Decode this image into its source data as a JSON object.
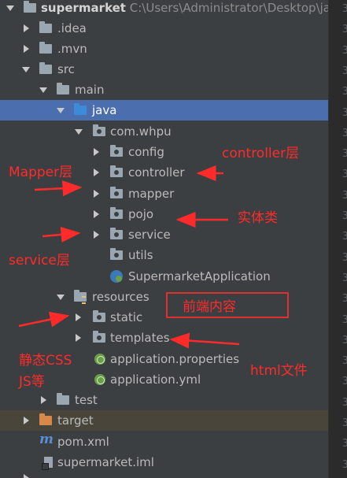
{
  "project": {
    "name": "supermarket",
    "path": "C:\\Users\\Administrator\\Desktop\\java"
  },
  "tree": {
    "idea": ".idea",
    "mvn": ".mvn",
    "src": "src",
    "main": "main",
    "java": "java",
    "package": "com.whpu",
    "config": "config",
    "controller": "controller",
    "mapper": "mapper",
    "pojo": "pojo",
    "service": "service",
    "utils": "utils",
    "app_class": "SupermarketApplication",
    "resources": "resources",
    "static": "static",
    "templates": "templates",
    "app_properties": "application.properties",
    "app_yml": "application.yml",
    "test": "test",
    "target": "target",
    "pom": "pom.xml",
    "iml": "supermarket.iml"
  },
  "gutter_numbers": [
    "3",
    "3",
    "3",
    "3",
    "3",
    "3",
    "3",
    "3",
    "3",
    "3",
    "3",
    "3",
    "3",
    "3",
    "3",
    "3",
    "3",
    "3",
    "3",
    "3",
    "3",
    "3",
    "3"
  ],
  "annotations": {
    "controller": "controller层",
    "mapper": "Mapper层",
    "pojo": "实体类",
    "service": "service层",
    "frontend": "前端内容",
    "static": "静态CSS",
    "static2": "JS等",
    "templates": "html文件"
  },
  "colors": {
    "annotation": "#ff2b2b",
    "selected_row": "#4b6eaf",
    "source_folder": "#3d8bd8",
    "excluded_folder": "#d58a4b"
  }
}
